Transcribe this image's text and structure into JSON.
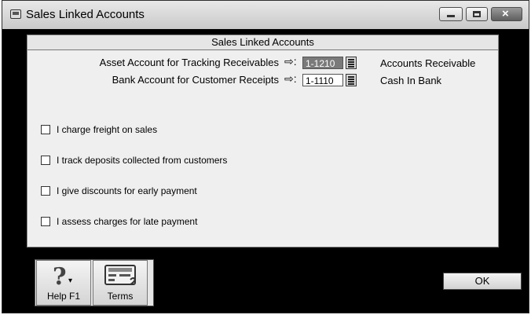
{
  "window": {
    "title": "Sales Linked Accounts"
  },
  "panel": {
    "header": "Sales Linked Accounts"
  },
  "fields": [
    {
      "label": "Asset Account for Tracking Receivables",
      "arrow": "⇨:",
      "account": "1-1210",
      "name": "Accounts Receivable"
    },
    {
      "label": "Bank Account for Customer Receipts",
      "arrow": "⇨:",
      "account": "1-1110",
      "name": "Cash In Bank"
    }
  ],
  "checkboxes": [
    {
      "label": "I charge freight on sales",
      "checked": false
    },
    {
      "label": "I track deposits collected from customers",
      "checked": false
    },
    {
      "label": "I give discounts for early payment",
      "checked": false
    },
    {
      "label": "I assess charges for late payment",
      "checked": false
    }
  ],
  "buttons": {
    "help": "Help F1",
    "terms": "Terms",
    "ok": "OK"
  },
  "icons": {
    "app": "window-icon",
    "help": "question-mark-icon",
    "terms": "card-icon"
  }
}
